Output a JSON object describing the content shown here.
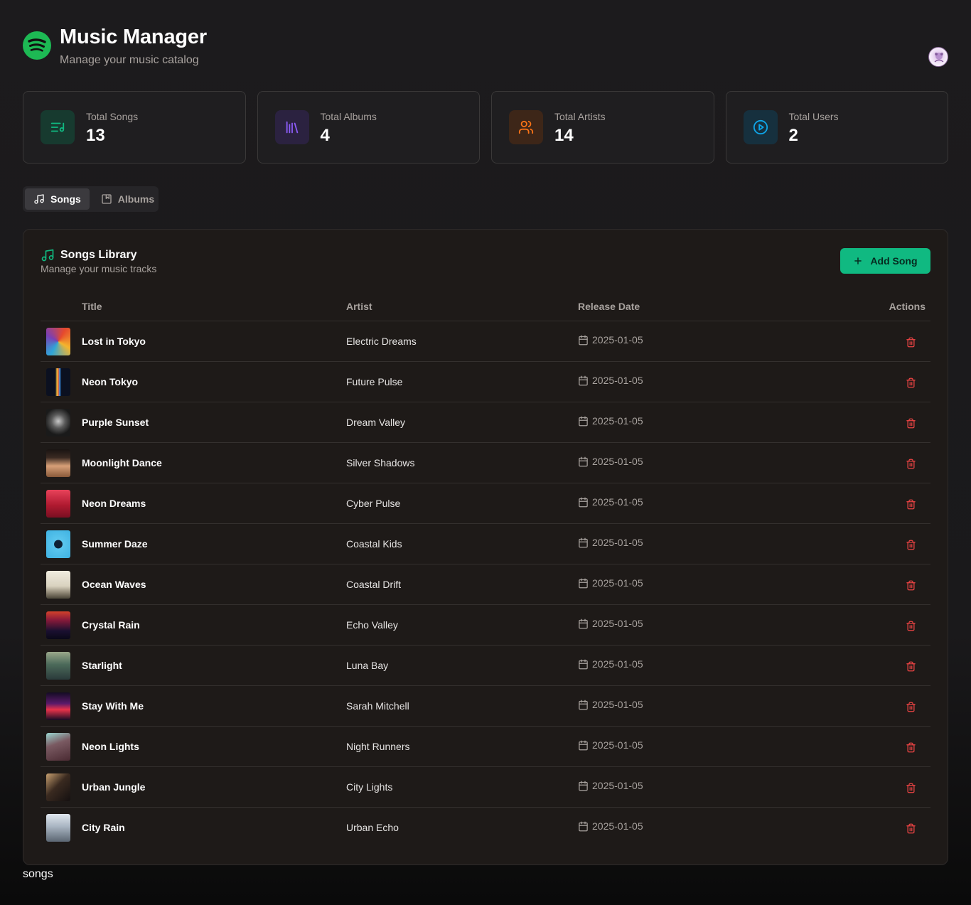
{
  "header": {
    "title": "Music Manager",
    "subtitle": "Manage your music catalog"
  },
  "stats": [
    {
      "label": "Total Songs",
      "value": "13",
      "icon": "playlist-icon",
      "color": "#10b981"
    },
    {
      "label": "Total Albums",
      "value": "4",
      "icon": "library-icon",
      "color": "#8b5cf6"
    },
    {
      "label": "Total Artists",
      "value": "14",
      "icon": "users-icon",
      "color": "#f97316"
    },
    {
      "label": "Total Users",
      "value": "2",
      "icon": "play-circle-icon",
      "color": "#0ea5e9"
    }
  ],
  "tabs": [
    {
      "label": "Songs",
      "icon": "music-note-icon",
      "active": true
    },
    {
      "label": "Albums",
      "icon": "album-icon",
      "active": false
    }
  ],
  "library": {
    "title": "Songs Library",
    "subtitle": "Manage your music tracks",
    "add_button": "Add Song",
    "columns": [
      "Title",
      "Artist",
      "Release Date",
      "Actions"
    ],
    "songs": [
      {
        "title": "Lost in Tokyo",
        "artist": "Electric Dreams",
        "date": "2025-01-05"
      },
      {
        "title": "Neon Tokyo",
        "artist": "Future Pulse",
        "date": "2025-01-05"
      },
      {
        "title": "Purple Sunset",
        "artist": "Dream Valley",
        "date": "2025-01-05"
      },
      {
        "title": "Moonlight Dance",
        "artist": "Silver Shadows",
        "date": "2025-01-05"
      },
      {
        "title": "Neon Dreams",
        "artist": "Cyber Pulse",
        "date": "2025-01-05"
      },
      {
        "title": "Summer Daze",
        "artist": "Coastal Kids",
        "date": "2025-01-05"
      },
      {
        "title": "Ocean Waves",
        "artist": "Coastal Drift",
        "date": "2025-01-05"
      },
      {
        "title": "Crystal Rain",
        "artist": "Echo Valley",
        "date": "2025-01-05"
      },
      {
        "title": "Starlight",
        "artist": "Luna Bay",
        "date": "2025-01-05"
      },
      {
        "title": "Stay With Me",
        "artist": "Sarah Mitchell",
        "date": "2025-01-05"
      },
      {
        "title": "Neon Lights",
        "artist": "Night Runners",
        "date": "2025-01-05"
      },
      {
        "title": "Urban Jungle",
        "artist": "City Lights",
        "date": "2025-01-05"
      },
      {
        "title": "City Rain",
        "artist": "Urban Echo",
        "date": "2025-01-05"
      }
    ]
  },
  "footer_label": "songs",
  "colors": {
    "accent": "#10b981",
    "danger": "#ef4444",
    "background": "#1c1b1d"
  }
}
